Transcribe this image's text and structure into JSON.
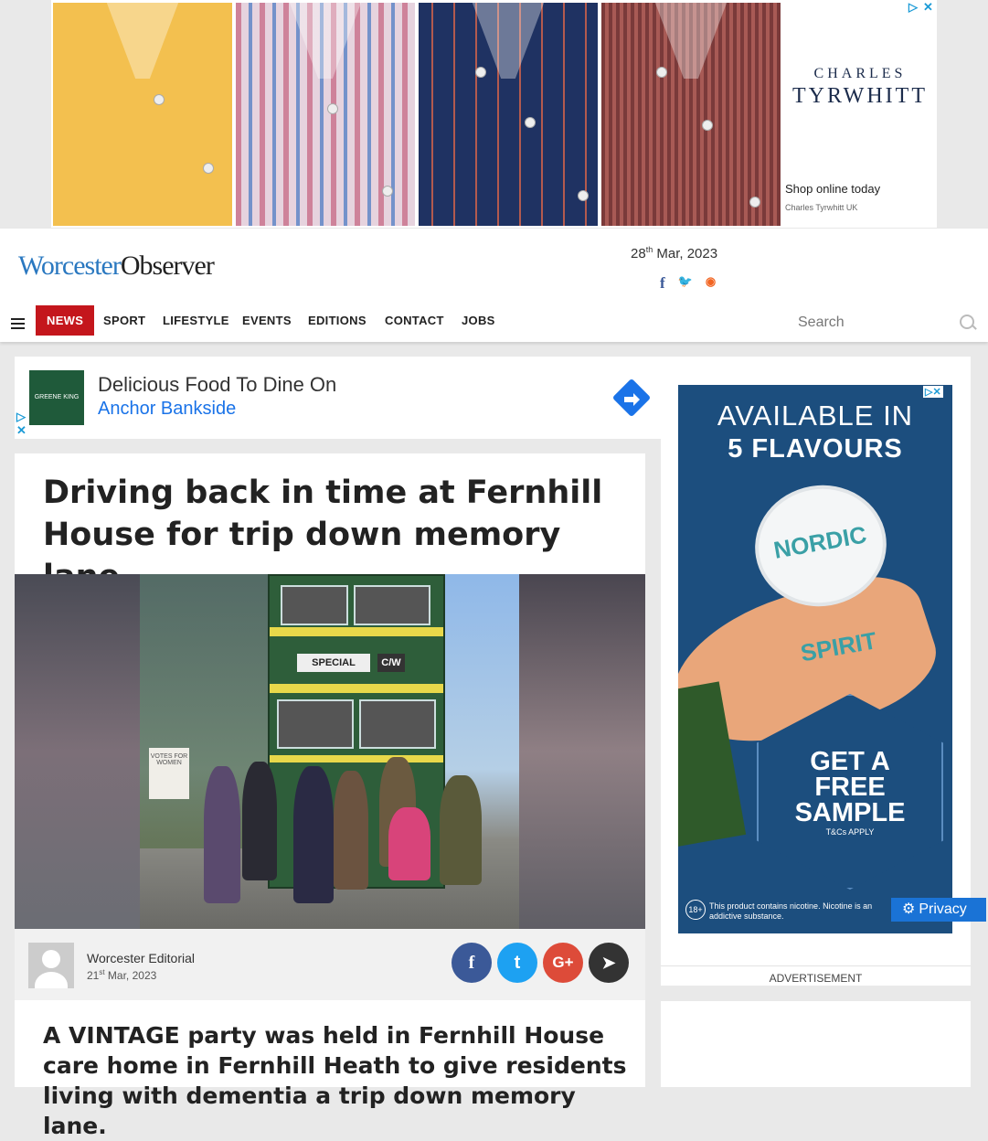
{
  "top_ad": {
    "brand_line1": "CHARLES",
    "brand_line2": "TYRWHITT",
    "cta": "Shop online today",
    "advertiser": "Charles Tyrwhitt UK",
    "shirts": [
      {
        "name": "yellow-shirt",
        "color": "#f3c04f"
      },
      {
        "name": "pink-check-shirt",
        "color": "#c7a5b8"
      },
      {
        "name": "navy-check-shirt",
        "color": "#243a6e"
      },
      {
        "name": "red-check-shirt",
        "color": "#8c4a48"
      }
    ]
  },
  "header": {
    "logo_part1": "Worcester",
    "logo_part2": "Observer",
    "date_day": "28",
    "date_suffix": "th",
    "date_rest": " Mar, 2023",
    "social": {
      "facebook": "f",
      "twitter": "🐦",
      "rss": "◉"
    },
    "nav": [
      "NEWS",
      "SPORT",
      "LIFESTYLE",
      "EVENTS",
      "EDITIONS",
      "CONTACT",
      "JOBS"
    ],
    "search_placeholder": "Search"
  },
  "small_ad": {
    "logo_text": "GREENE KING",
    "title": "Delicious Food To Dine On",
    "subtitle": "Anchor Bankside"
  },
  "article": {
    "headline": "Driving back in time at Fernhill House for trip down memory lane",
    "photo": {
      "bus_sign_1": "SPECIAL",
      "bus_sign_2": "C/W",
      "placard": "VOTES FOR WOMEN"
    },
    "author": "Worcester Editorial",
    "date_day": "21",
    "date_suffix": "st",
    "date_rest": " Mar, 2023",
    "share": {
      "facebook": "f",
      "twitter": "t",
      "google": "G+",
      "telegram": "➤"
    },
    "intro": "A VINTAGE party was held in Fernhill House care home in Fernhill Heath to give residents living with dementia a trip down memory lane."
  },
  "side_ad": {
    "line1": "AVAILABLE IN",
    "line2": "5 FLAVOURS",
    "can": "NORDIC SPIRIT",
    "cta": "GET A FREE SAMPLE",
    "tc": "T&Cs APPLY",
    "age": "18+",
    "warning": "This product contains nicotine. Nicotine is an addictive substance.",
    "label": "ADVERTISEMENT"
  },
  "privacy": "Privacy"
}
